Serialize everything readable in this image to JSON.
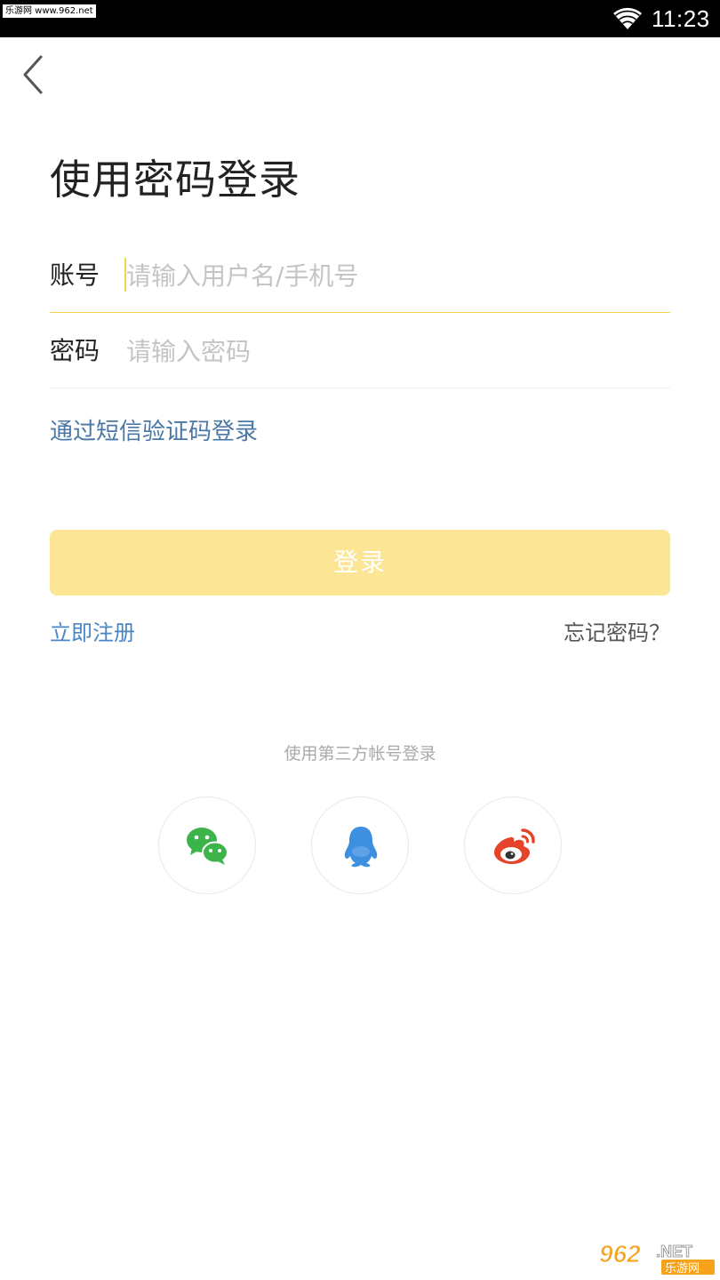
{
  "status_bar": {
    "watermark": "乐游网 www.962.net",
    "time": "11:23",
    "wifi_icon": "wifi-icon"
  },
  "header": {
    "back_icon": "chevron-left-icon"
  },
  "page": {
    "title": "使用密码登录"
  },
  "form": {
    "account": {
      "label": "账号",
      "placeholder": "请输入用户名/手机号",
      "value": ""
    },
    "password": {
      "label": "密码",
      "placeholder": "请输入密码",
      "value": ""
    },
    "sms_login_link": "通过短信验证码登录",
    "login_button": "登录",
    "register_link": "立即注册",
    "forgot_link": "忘记密码？"
  },
  "third_party": {
    "label": "使用第三方帐号登录",
    "providers": [
      {
        "name": "wechat",
        "icon": "wechat-icon",
        "color": "#3cb449"
      },
      {
        "name": "qq",
        "icon": "qq-icon",
        "color": "#3d8fe0"
      },
      {
        "name": "weibo",
        "icon": "weibo-icon",
        "color": "#e6442a"
      }
    ]
  },
  "colors": {
    "accent": "#f5d44a",
    "button_disabled": "#fce594",
    "link_blue": "#4a77a6",
    "register_blue": "#4a86c5"
  },
  "watermark_br": {
    "logo": "962.NET",
    "sub": "乐游网"
  }
}
